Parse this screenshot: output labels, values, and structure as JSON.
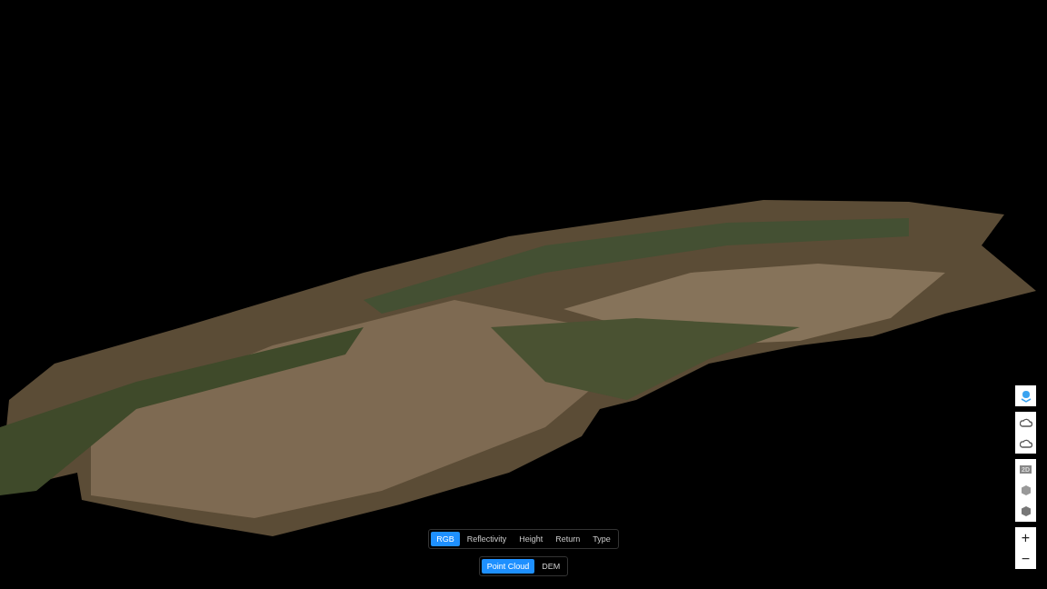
{
  "color_modes": [
    {
      "label": "RGB",
      "selected": true
    },
    {
      "label": "Reflectivity",
      "selected": false
    },
    {
      "label": "Height",
      "selected": false
    },
    {
      "label": "Return",
      "selected": false
    },
    {
      "label": "Type",
      "selected": false
    }
  ],
  "view_modes": [
    {
      "label": "Point Cloud",
      "selected": true
    },
    {
      "label": "DEM",
      "selected": false
    }
  ],
  "toolbar": {
    "view_2d_label": "2D",
    "zoom_in": "+",
    "zoom_out": "−"
  }
}
